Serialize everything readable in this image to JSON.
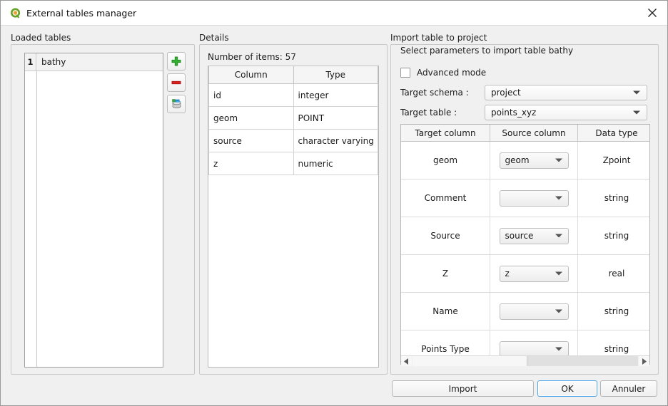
{
  "window": {
    "title": "External tables manager",
    "app_icon": "qgis-logo-icon",
    "close_icon": "close-icon"
  },
  "loaded_tables": {
    "group_label": "Loaded tables",
    "rows": [
      {
        "num": "1",
        "name": "bathy"
      }
    ],
    "buttons": [
      {
        "name": "add-table-button",
        "icon": "plus-icon"
      },
      {
        "name": "remove-table-button",
        "icon": "minus-icon"
      },
      {
        "name": "load-from-database-button",
        "icon": "database-import-icon"
      }
    ]
  },
  "details": {
    "group_label": "Details",
    "count_text": "Number of items: 57",
    "headers": [
      "Column",
      "Type"
    ],
    "rows": [
      [
        "id",
        "integer"
      ],
      [
        "geom",
        "POINT"
      ],
      [
        "source",
        "character varying"
      ],
      [
        "z",
        "numeric"
      ]
    ]
  },
  "import": {
    "group_label": "Import table to project",
    "instruction": "Select parameters to import table bathy",
    "advanced_mode_label": "Advanced mode",
    "advanced_mode_checked": false,
    "target_schema_label": "Target schema :",
    "target_schema_value": "project",
    "target_table_label": "Target table :",
    "target_table_value": "points_xyz",
    "mapping_headers": [
      "Target column",
      "Source column",
      "Data type"
    ],
    "mapping_rows": [
      {
        "target": "geom",
        "source": "geom",
        "type": "Zpoint"
      },
      {
        "target": "Comment",
        "source": "",
        "type": "string"
      },
      {
        "target": "Source",
        "source": "source",
        "type": "string"
      },
      {
        "target": "Z",
        "source": "z",
        "type": "real"
      },
      {
        "target": "Name",
        "source": "",
        "type": "string"
      },
      {
        "target": "Points Type",
        "source": "",
        "type": "string"
      }
    ],
    "scrollbar": {
      "left_arrow_icon": "triangle-left-icon",
      "right_arrow_icon": "triangle-right-icon"
    }
  },
  "footer": {
    "import_label": "Import",
    "ok_label": "OK",
    "cancel_label": "Annuler"
  },
  "colors": {
    "accent": "#4da3e8",
    "add": "#33aa33",
    "remove": "#d81f1f",
    "logo_green": "#6aa32c",
    "logo_orange": "#e8a33d"
  }
}
